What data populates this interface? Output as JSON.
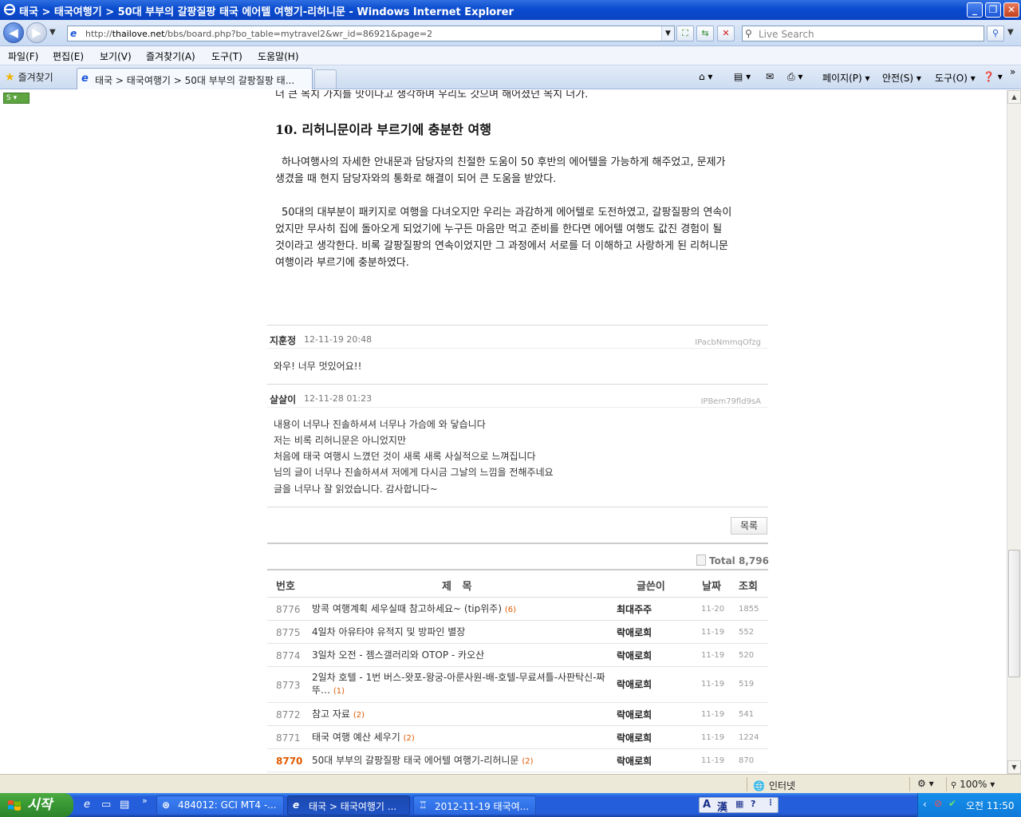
{
  "window": {
    "title": "태국 > 태국여행기 > 50대 부부의 갈팡질팡 태국 에어텔 여행기-리허니문 - Windows Internet Explorer",
    "min": "_",
    "max": "❐",
    "close": "✕"
  },
  "address": {
    "url_prefix": "http://",
    "url_host": "thailove.net",
    "url_rest": "/bbs/board.php?bo_table=mytravel2&wr_id=86921&page=2",
    "search_placeholder": "Live Search"
  },
  "menu": [
    "파일(F)",
    "편집(E)",
    "보기(V)",
    "즐겨찾기(A)",
    "도구(T)",
    "도움말(H)"
  ],
  "tabbar": {
    "favorites": "즐겨찾기",
    "tab_title": "태국 > 태국여행기 > 50대 부부의 갈팡질팡 태...",
    "page_menu": "페이지(P)",
    "safety_menu": "안전(S)",
    "tools_menu": "도구(O)"
  },
  "article": {
    "cut_line": "더 큰 목치 가치를 맛이다고 생각하며 우리도 갓으며 해어졌던 목치 더가.",
    "heading": "10. 리허니문이라 부르기에 충분한 여행",
    "para1": "하나여행사의 자세한 안내문과 담당자의 친절한 도움이 50 후반의 에어텔을 가능하게 해주었고, 문제가 생겼을 때 현지 담당자와의 통화로 해결이 되어 큰 도움을 받았다.",
    "para2": "50대의 대부분이 패키지로 여행을 다녀오지만 우리는 과감하게 에어텔로 도전하였고, 갈팡질팡의 연속이었지만 무사히 집에 돌아오게 되었기에 누구든 마음만 먹고 준비를 한다면 에어텔 여행도 값진 경험이 될 것이라고 생각한다. 비록 갈팡질팡의 연속이었지만 그 과정에서 서로를 더 이해하고 사랑하게 된 리허니문 여행이라 부르기에 충분하였다."
  },
  "comments": [
    {
      "author": "지훈정",
      "date": "12-11-19 20:48",
      "ip": "IPacbNmmqOfzg",
      "lines": [
        "와우! 너무 멋있어요!!"
      ]
    },
    {
      "author": "살살이",
      "date": "12-11-28 01:23",
      "ip": "IPBem79fld9sA",
      "lines": [
        "내용이 너무나 진솔하셔셔 너무나 가슴에 와 닿습니다",
        "저는 비록 리허니문은 아니었지만",
        "처음에 태국 여행시 느꼈던 것이 새록 새록 사실적으로 느껴집니다",
        "님의 글이 너무나 진솔하셔셔 저에게 다시금 그날의 느낌을 전해주네요",
        "글을 너무나 잘 읽었습니다. 감사합니다~"
      ]
    }
  ],
  "list_button": "목록",
  "board": {
    "total": "Total 8,796",
    "headers": {
      "num": "번호",
      "subject": "제   목",
      "author": "글쓴이",
      "date": "날짜",
      "hits": "조회"
    },
    "rows": [
      {
        "num": "8776",
        "subject": "방콕 여행계획 세우실때 참고하세요~ (tip위주)",
        "count": "(6)",
        "author": "최대주주",
        "date": "11-20",
        "hits": "1855"
      },
      {
        "num": "8775",
        "subject": "4일차 아유타야 유적지 및 방파인 별장",
        "count": "",
        "author": "락애로희",
        "date": "11-19",
        "hits": "552"
      },
      {
        "num": "8774",
        "subject": "3일차 오전 - 젬스갤러리와 OTOP - 카오산",
        "count": "",
        "author": "락애로희",
        "date": "11-19",
        "hits": "520"
      },
      {
        "num": "8773",
        "subject": "2일차 호텔 - 1번 버스-왓포-왕궁-아룬사원-배-호텔-무료셔틀-사판탁신-짜뚜…",
        "count": "(1)",
        "author": "락애로희",
        "date": "11-19",
        "hits": "519"
      },
      {
        "num": "8772",
        "subject": "참고 자료",
        "count": "(2)",
        "author": "락애로희",
        "date": "11-19",
        "hits": "541"
      },
      {
        "num": "8771",
        "subject": "태국 여행 예산 세우기",
        "count": "(2)",
        "author": "락애로희",
        "date": "11-19",
        "hits": "1224"
      },
      {
        "num": "8770",
        "subject": "50대 부부의 갈팡질팡 태국 에어텔 여행기-리허니문",
        "count": "(2)",
        "author": "락애로희",
        "date": "11-19",
        "hits": "870"
      }
    ]
  },
  "status": {
    "zone": "인터넷",
    "zoom": "100%"
  },
  "taskbar": {
    "start": "시작",
    "tasks": [
      "484012: GCI MT4 -...",
      "태국 > 태국여행기 ...",
      "2012-11-19 태국여..."
    ],
    "ime_a": "A",
    "ime_han": "漢",
    "clock": "오전 11:50"
  }
}
